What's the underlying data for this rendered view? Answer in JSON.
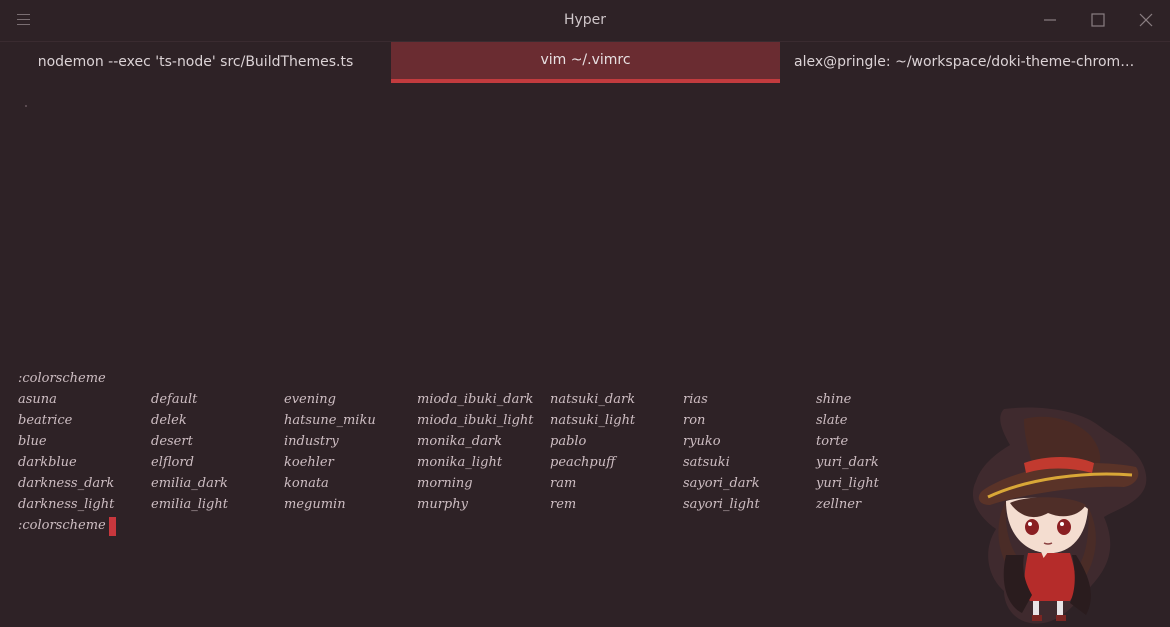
{
  "window": {
    "title": "Hyper"
  },
  "tabs": [
    {
      "label": "nodemon --exec 'ts-node' src/BuildThemes.ts"
    },
    {
      "label": "vim ~/.vimrc"
    },
    {
      "label": "alex@pringle: ~/workspace/doki-theme-chrome/…"
    }
  ],
  "terminal": {
    "command_top": ":colorscheme",
    "prompt": ":colorscheme",
    "columns": [
      [
        "asuna",
        "beatrice",
        "blue",
        "darkblue",
        "darkness_dark",
        "darkness_light"
      ],
      [
        "default",
        "delek",
        "desert",
        "elflord",
        "emilia_dark",
        "emilia_light"
      ],
      [
        "evening",
        "hatsune_miku",
        "industry",
        "koehler",
        "konata",
        "megumin"
      ],
      [
        "mioda_ibuki_dark",
        "mioda_ibuki_light",
        "monika_dark",
        "monika_light",
        "morning",
        "murphy"
      ],
      [
        "natsuki_dark",
        "natsuki_light",
        "pablo",
        "peachpuff",
        "ram",
        "rem"
      ],
      [
        "rias",
        "ron",
        "ryuko",
        "satsuki",
        "sayori_dark",
        "sayori_light"
      ],
      [
        "shine",
        "slate",
        "torte",
        "yuri_dark",
        "yuri_light",
        "zellner"
      ]
    ]
  },
  "colors": {
    "background": "#2e2226",
    "active_tab": "#6a2c31",
    "accent": "#c23b3e",
    "text": "#cdbdc2"
  },
  "icons": {
    "menu": "hamburger-menu-icon",
    "minimize": "minimize-icon",
    "maximize": "maximize-icon",
    "close": "close-icon"
  }
}
